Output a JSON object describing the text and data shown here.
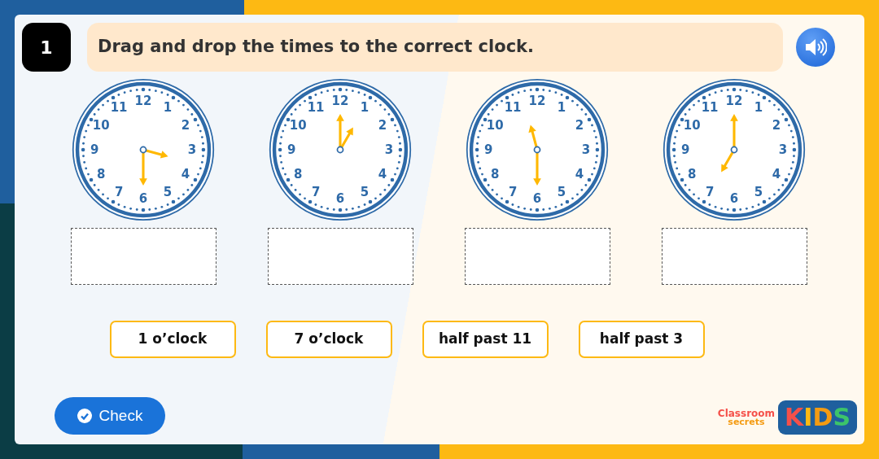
{
  "question": {
    "number": "1",
    "instruction": "Drag and drop the times to the correct clock."
  },
  "clocks": [
    {
      "numerals": [
        {
          "label": "12",
          "hour_hand": false,
          "minute_hand": false
        },
        {
          "label": "1",
          "hour_hand": false,
          "minute_hand": false
        },
        {
          "label": "2",
          "hour_hand": false,
          "minute_hand": false
        },
        {
          "label": "3",
          "hour_hand": true,
          "minute_hand": false
        },
        {
          "label": "4",
          "hour_hand": false,
          "minute_hand": false
        },
        {
          "label": "5",
          "hour_hand": false,
          "minute_hand": false
        },
        {
          "label": "6",
          "hour_hand": false,
          "minute_hand": true
        },
        {
          "label": "7",
          "hour_hand": false,
          "minute_hand": false
        },
        {
          "label": "8",
          "hour_hand": false,
          "minute_hand": false
        },
        {
          "label": "9",
          "hour_hand": false,
          "minute_hand": false
        },
        {
          "label": "10",
          "hour_hand": false,
          "minute_hand": false
        },
        {
          "label": "11",
          "hour_hand": false,
          "minute_hand": false
        }
      ]
    },
    {
      "numerals": [
        {
          "label": "12",
          "hour_hand": false,
          "minute_hand": true
        },
        {
          "label": "1",
          "hour_hand": true,
          "minute_hand": false
        },
        {
          "label": "2",
          "hour_hand": false,
          "minute_hand": false
        },
        {
          "label": "3",
          "hour_hand": false,
          "minute_hand": false
        },
        {
          "label": "4",
          "hour_hand": false,
          "minute_hand": false
        },
        {
          "label": "5",
          "hour_hand": false,
          "minute_hand": false
        },
        {
          "label": "6",
          "hour_hand": false,
          "minute_hand": false
        },
        {
          "label": "7",
          "hour_hand": false,
          "minute_hand": false
        },
        {
          "label": "8",
          "hour_hand": false,
          "minute_hand": false
        },
        {
          "label": "9",
          "hour_hand": false,
          "minute_hand": false
        },
        {
          "label": "10",
          "hour_hand": false,
          "minute_hand": false
        },
        {
          "label": "11",
          "hour_hand": false,
          "minute_hand": false
        }
      ]
    },
    {
      "numerals": [
        {
          "label": "12",
          "hour_hand": false,
          "minute_hand": false
        },
        {
          "label": "1",
          "hour_hand": false,
          "minute_hand": false
        },
        {
          "label": "2",
          "hour_hand": false,
          "minute_hand": false
        },
        {
          "label": "3",
          "hour_hand": false,
          "minute_hand": false
        },
        {
          "label": "4",
          "hour_hand": false,
          "minute_hand": false
        },
        {
          "label": "5",
          "hour_hand": false,
          "minute_hand": false
        },
        {
          "label": "6",
          "hour_hand": false,
          "minute_hand": true
        },
        {
          "label": "7",
          "hour_hand": false,
          "minute_hand": false
        },
        {
          "label": "8",
          "hour_hand": false,
          "minute_hand": false
        },
        {
          "label": "9",
          "hour_hand": false,
          "minute_hand": false
        },
        {
          "label": "10",
          "hour_hand": false,
          "minute_hand": false
        },
        {
          "label": "11",
          "hour_hand": true,
          "minute_hand": false
        }
      ]
    },
    {
      "numerals": [
        {
          "label": "12",
          "hour_hand": false,
          "minute_hand": true
        },
        {
          "label": "1",
          "hour_hand": false,
          "minute_hand": false
        },
        {
          "label": "2",
          "hour_hand": false,
          "minute_hand": false
        },
        {
          "label": "3",
          "hour_hand": false,
          "minute_hand": false
        },
        {
          "label": "4",
          "hour_hand": false,
          "minute_hand": false
        },
        {
          "label": "5",
          "hour_hand": false,
          "minute_hand": false
        },
        {
          "label": "6",
          "hour_hand": false,
          "minute_hand": false
        },
        {
          "label": "7",
          "hour_hand": true,
          "minute_hand": false
        },
        {
          "label": "8",
          "hour_hand": false,
          "minute_hand": false
        },
        {
          "label": "9",
          "hour_hand": false,
          "minute_hand": false
        },
        {
          "label": "10",
          "hour_hand": false,
          "minute_hand": false
        },
        {
          "label": "11",
          "hour_hand": false,
          "minute_hand": false
        }
      ]
    }
  ],
  "answers": [
    "1 o’clock",
    "7 o’clock",
    "half past 11",
    "half past 3"
  ],
  "check_button": {
    "label": "Check"
  },
  "logo": {
    "line1": "Classroom",
    "line2": "secrets",
    "badge": "KIDS"
  }
}
